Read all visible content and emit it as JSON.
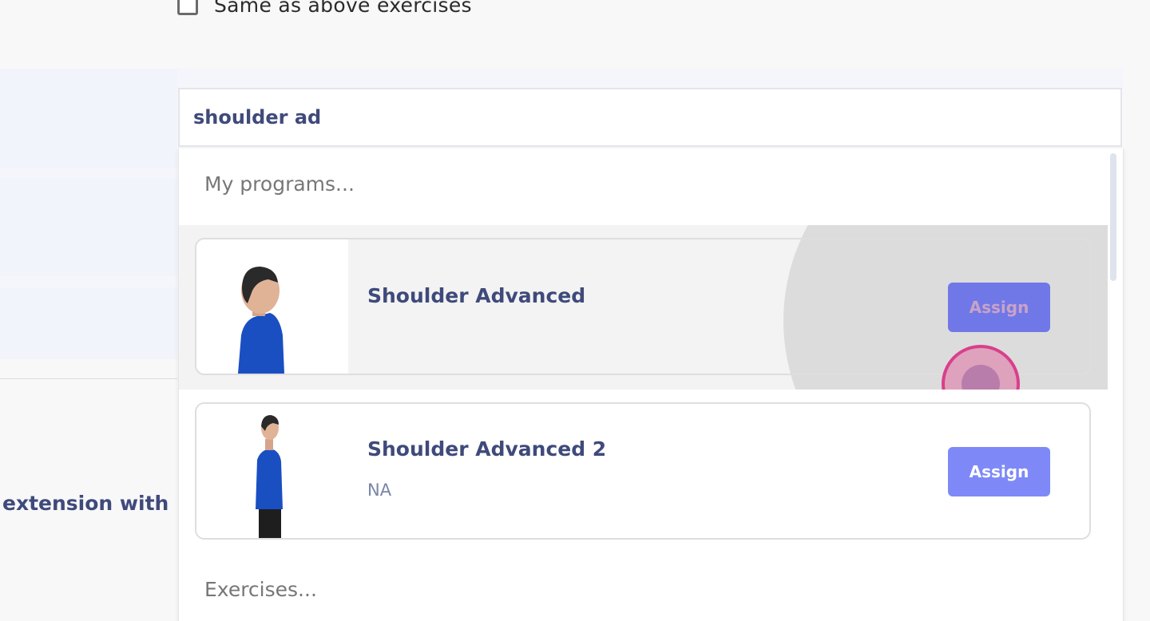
{
  "form": {
    "same_as_above_label": "Same as above exercises",
    "left_text": "extension with"
  },
  "search": {
    "value": "shoulder ad"
  },
  "dropdown": {
    "programs_heading": "My programs...",
    "exercises_heading": "Exercises...",
    "programs": [
      {
        "title": "Shoulder Advanced",
        "subtitle": "",
        "button_label": "Assign"
      },
      {
        "title": "Shoulder Advanced 2",
        "subtitle": "NA",
        "button_label": "Assign"
      }
    ]
  },
  "colors": {
    "accent": "#7e89f7",
    "title_text": "#3f4a7b",
    "tap_indicator": "#d93f8c"
  }
}
